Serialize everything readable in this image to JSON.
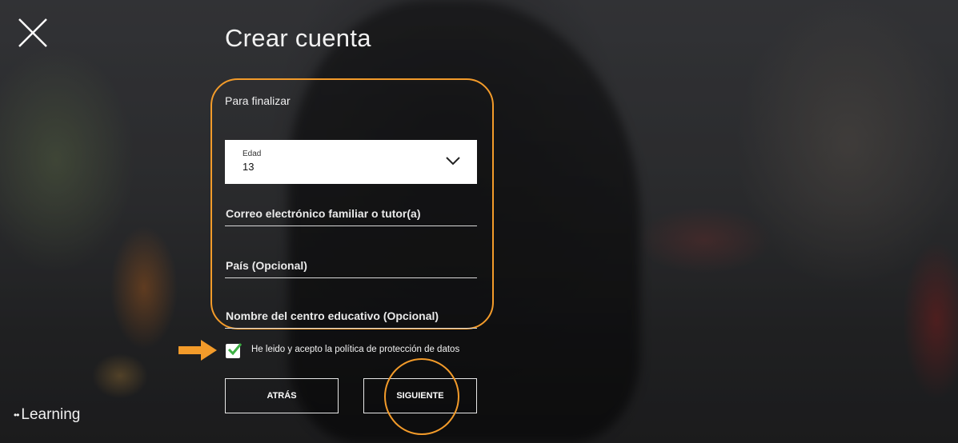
{
  "page": {
    "title": "Crear cuenta",
    "subtitle": "Para finalizar"
  },
  "form": {
    "age": {
      "label": "Edad",
      "value": "13"
    },
    "guardian_email": {
      "placeholder": "Correo electrónico familiar o tutor(a)"
    },
    "country": {
      "placeholder": "País (Opcional)"
    },
    "school": {
      "placeholder": "Nombre del centro educativo (Opcional)"
    },
    "consent": {
      "label": "He leido y acepto la política de protección de datos",
      "checked": true
    }
  },
  "buttons": {
    "back": "ATRÁS",
    "next": "SIGUIENTE"
  },
  "brand": {
    "logo_dots": "••",
    "logo_text": "Learning"
  },
  "icons": {
    "close": "close-icon",
    "dropdown": "chevron-down-icon",
    "checkmark": "checkmark-icon",
    "pointer": "arrow-right-icon"
  },
  "colors": {
    "highlight": "#f39b2a",
    "checkmark": "#3cb044"
  }
}
